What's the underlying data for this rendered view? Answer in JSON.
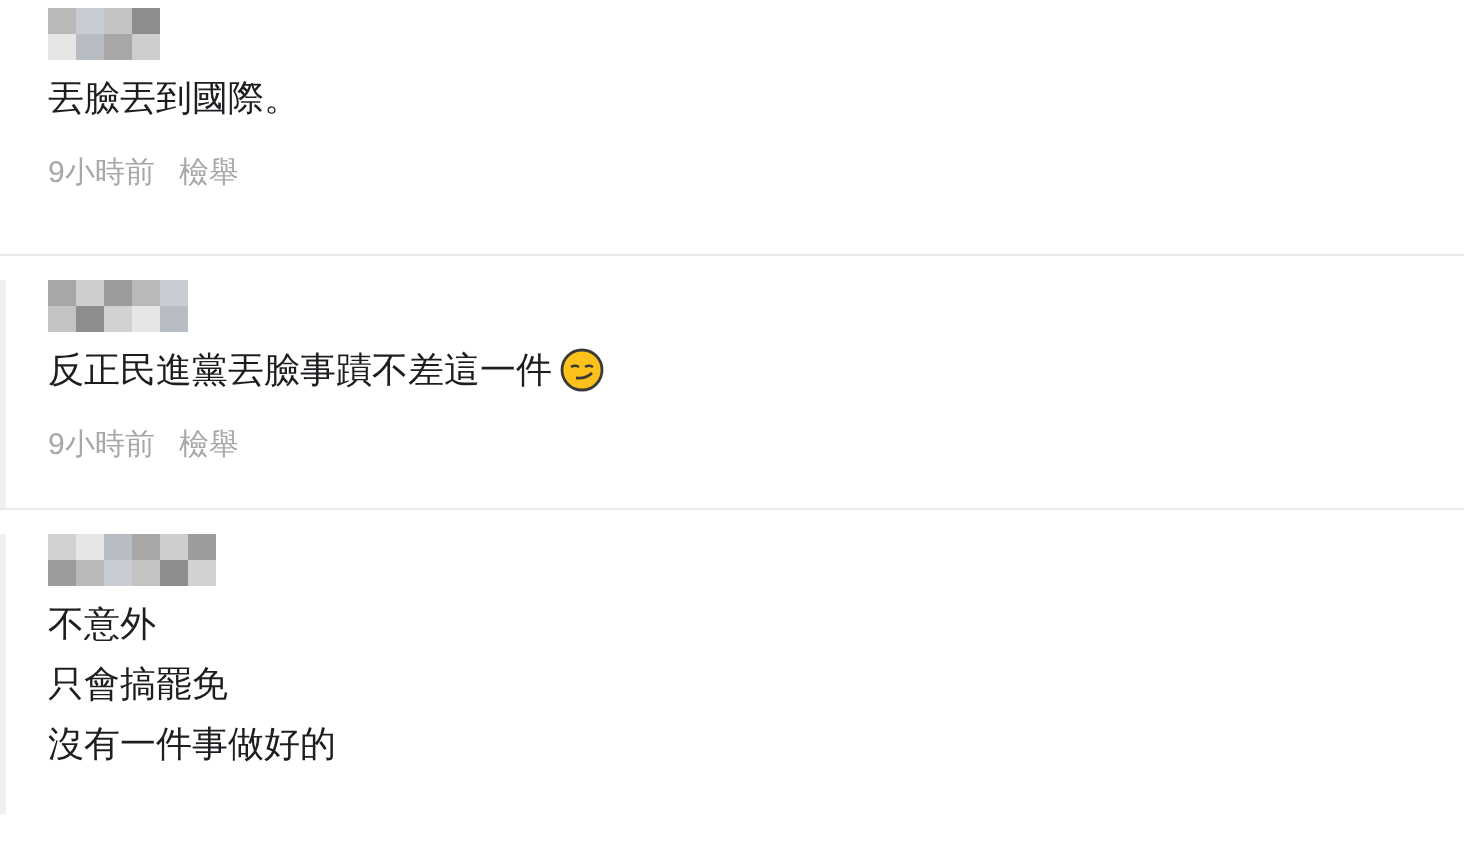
{
  "comments": [
    {
      "thread_line": false,
      "lines": [
        "丟臉丟到國際。"
      ],
      "emoji": false,
      "time": "9小時前",
      "report": "檢舉"
    },
    {
      "thread_line": true,
      "lines": [
        "反正民進黨丟臉事蹟不差這一件"
      ],
      "emoji": true,
      "time": "9小時前",
      "report": "檢舉"
    },
    {
      "thread_line": true,
      "lines": [
        "不意外",
        "只會搞罷免",
        "沒有一件事做好的"
      ],
      "emoji": false
    }
  ]
}
